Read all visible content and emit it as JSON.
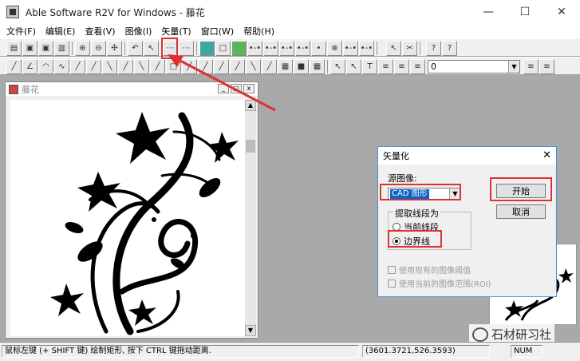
{
  "app": {
    "title": "Able Software R2V for Windows - 藤花"
  },
  "window_controls": {
    "minimize": "—",
    "maximize": "☐",
    "close": "✕"
  },
  "menu": [
    "文件(F)",
    "编辑(E)",
    "查看(V)",
    "图像(I)",
    "矢量(T)",
    "窗口(W)",
    "帮助(H)"
  ],
  "toolbar": {
    "layer_value": "0"
  },
  "document": {
    "title": "藤花"
  },
  "dialog": {
    "title": "矢量化",
    "close": "✕",
    "source_label": "源图像:",
    "source_value": "CAD 图形",
    "extract_label": "提取线段为",
    "radio_current": "当前线段",
    "radio_boundary": "边界线",
    "radio_selected": "boundary",
    "check1": "使用现有的图像阈值",
    "check2": "使用当前的图像范围(ROI)",
    "start_button": "开始",
    "cancel_button": "取消"
  },
  "watermark": {
    "text": "石材研习社"
  },
  "status": {
    "hint": "鼠标左键 (+ SHIFT 键) 绘制矩形, 按下 CTRL 键拖动距离.",
    "coords": "(3601.3721,526.3593)",
    "num": "NUM"
  },
  "colors": {
    "highlight": "#e03030",
    "selection": "#0a64c8"
  }
}
